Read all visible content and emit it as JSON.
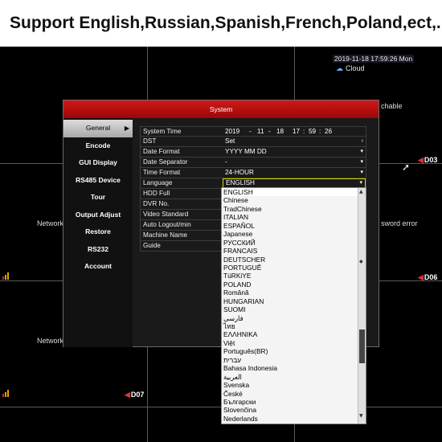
{
  "banner": {
    "text": "Support English,Russian,Spanish,French,Poland,ect,."
  },
  "overlay": {
    "clock": "2019-11-18 17:59:26 Mon",
    "cloud": "Cloud",
    "cells": {
      "network_left_1": "Network",
      "network_left_2": "Network",
      "chable": "chable",
      "password_error": "sword error",
      "d03": "D03",
      "d06": "D06",
      "d07": "D07"
    }
  },
  "window": {
    "title": "System",
    "sidebar": [
      {
        "label": "General",
        "active": true
      },
      {
        "label": "Encode"
      },
      {
        "label": "GUI Display"
      },
      {
        "label": "RS485 Device"
      },
      {
        "label": "Tour"
      },
      {
        "label": "Output Adjust"
      },
      {
        "label": "Restore"
      },
      {
        "label": "RS232"
      },
      {
        "label": "Account"
      }
    ],
    "form": {
      "system_time": {
        "label": "System Time",
        "year": "2019",
        "month": "11",
        "day": "18",
        "hour": "17",
        "minute": "59",
        "second": "26"
      },
      "dst": {
        "label": "DST",
        "value": "Set"
      },
      "date_format": {
        "label": "Date Format",
        "value": "YYYY MM DD"
      },
      "date_separator": {
        "label": "Date Separator",
        "value": "-"
      },
      "time_format": {
        "label": "Time Format",
        "value": "24-HOUR"
      },
      "language": {
        "label": "Language",
        "value": "ENGLISH"
      },
      "hdd_full": {
        "label": "HDD Full"
      },
      "dvr_no": {
        "label": "DVR No."
      },
      "video_standard": {
        "label": "Video Standard"
      },
      "auto_logout": {
        "label": "Auto Logout/min"
      },
      "machine_name": {
        "label": "Machine Name"
      },
      "guide": {
        "label": "Guide"
      }
    },
    "language_options": [
      "ENGLISH",
      "Chinese",
      "TradChinese",
      "ITALIAN",
      "ESPAÑOL",
      "Japanese",
      "РУССКИЙ",
      "FRANCAIS",
      "DEUTSCHER",
      "PORTUGUÊ",
      "TüRKiYE",
      "POLAND",
      "Română",
      "HUNGARIAN",
      "SUOMI",
      "فارسی",
      "ไทย",
      "ΕΛΛΗΝΙΚΑ",
      "Việt",
      "Português(BR)",
      "עברית",
      "Bahasa Indonesia",
      "العربية",
      "Svenska",
      "České",
      "Български",
      "Slovenčina",
      "Nederlands"
    ]
  },
  "colors": {
    "title_red": "#c81010",
    "language_border": "#d6d600",
    "signal_orange": "#e8a000"
  }
}
